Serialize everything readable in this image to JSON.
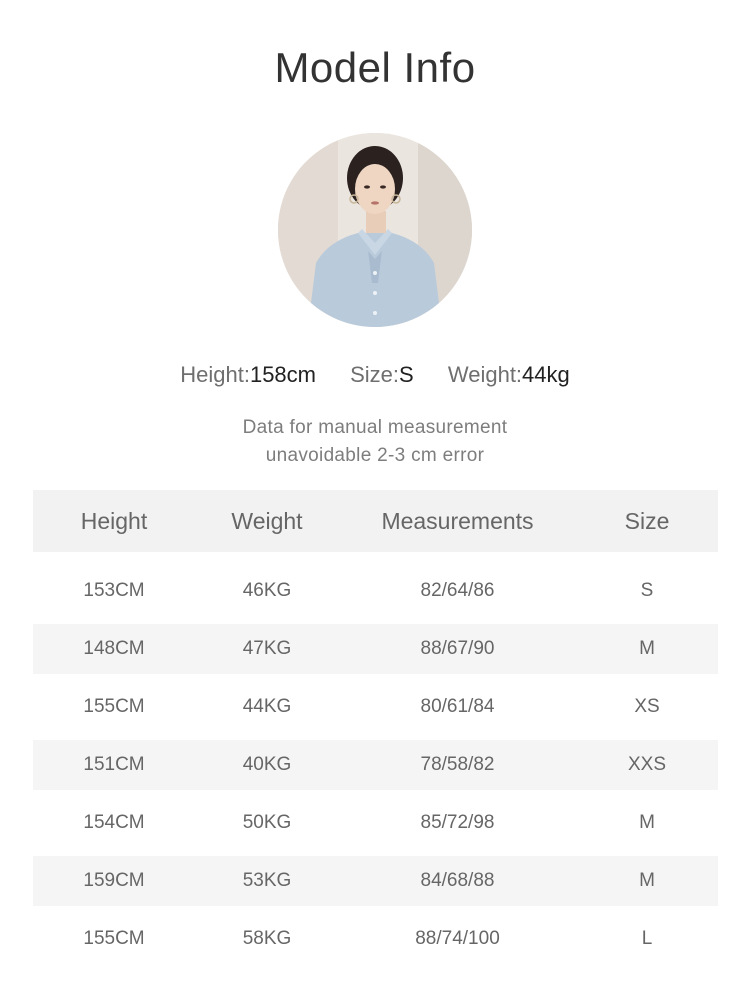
{
  "title": "Model Info",
  "model_stats": {
    "height_label": "Height:",
    "height_value": "158cm",
    "size_label": "Size:",
    "size_value": "S",
    "weight_label": "Weight:",
    "weight_value": "44kg"
  },
  "note": {
    "line1": "Data for manual measurement",
    "line2": "unavoidable 2-3 cm error"
  },
  "table": {
    "headers": [
      "Height",
      "Weight",
      "Measurements",
      "Size"
    ],
    "rows": [
      [
        "153CM",
        "46KG",
        "82/64/86",
        "S"
      ],
      [
        "148CM",
        "47KG",
        "88/67/90",
        "M"
      ],
      [
        "155CM",
        "44KG",
        "80/61/84",
        "XS"
      ],
      [
        "151CM",
        "40KG",
        "78/58/82",
        "XXS"
      ],
      [
        "154CM",
        "50KG",
        "85/72/98",
        "M"
      ],
      [
        "159CM",
        "53KG",
        "84/68/88",
        "M"
      ],
      [
        "155CM",
        "58KG",
        "88/74/100",
        "L"
      ]
    ]
  }
}
